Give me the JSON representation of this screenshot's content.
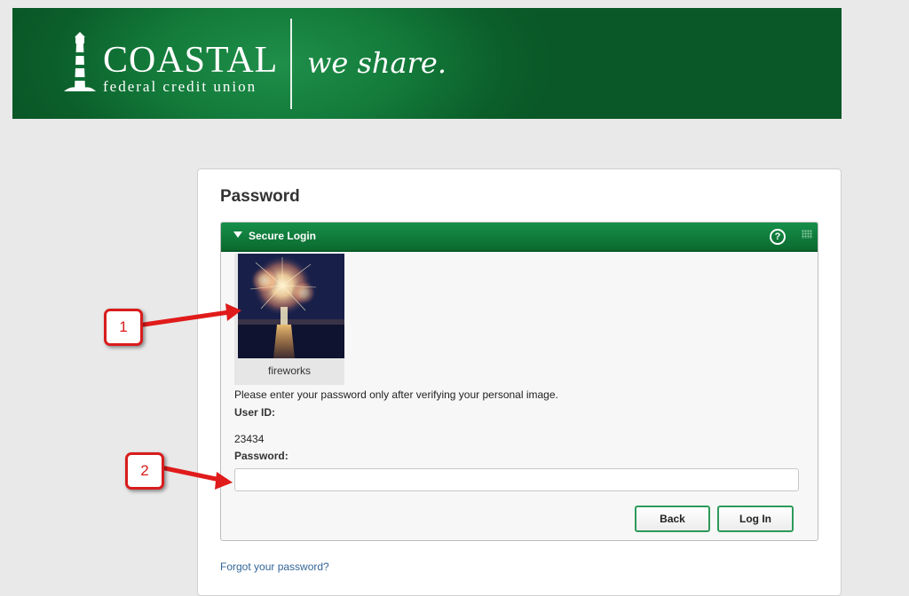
{
  "banner": {
    "brand_name": "COASTAL",
    "brand_sub": "federal credit union",
    "tagline": "we share."
  },
  "page": {
    "title": "Password"
  },
  "panel": {
    "title": "Secure Login",
    "help_glyph": "?",
    "icons": [
      "caret-down-icon",
      "help-icon",
      "grip-icon"
    ]
  },
  "personal_image": {
    "caption": "fireworks"
  },
  "form": {
    "instruction": "Please enter your password only after verifying your personal image.",
    "user_id_label": "User ID:",
    "user_id_value": "23434",
    "password_label": "Password:",
    "password_value": "",
    "back_label": "Back",
    "login_label": "Log In"
  },
  "links": {
    "forgot_password": "Forgot your password?"
  },
  "callouts": [
    "1",
    "2"
  ],
  "colors": {
    "brand_green": "#0b6a2f",
    "header_green": "#16904a",
    "button_border": "#2d9a5a",
    "link": "#336699",
    "callout_red": "#d91c1c"
  }
}
